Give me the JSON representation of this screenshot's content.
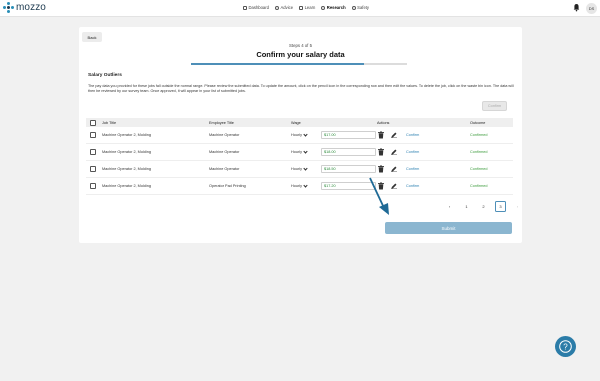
{
  "app": {
    "logo_text": "mozzo"
  },
  "nav": {
    "items": [
      {
        "label": "Dashboard",
        "icon": "dashboard-icon"
      },
      {
        "label": "Advice",
        "icon": "advice-icon"
      },
      {
        "label": "Learn",
        "icon": "learn-icon"
      },
      {
        "label": "Research",
        "icon": "research-icon",
        "active": true
      },
      {
        "label": "Safety",
        "icon": "safety-icon"
      }
    ]
  },
  "user": {
    "initials": "DS"
  },
  "page": {
    "back_label": "Back",
    "steps": "Steps 4 of 5",
    "title": "Confirm your salary data",
    "progress": 0.8
  },
  "section": {
    "title": "Salary Outliers",
    "description": "The pay data you provided for these jobs fall outside the normal range. Please review the submitted data. To update the amount, click on the pencil icon in the corresponding row and then edit the values. To delete the job, click on the waste bin icon. The data will then be reviewed by our survey team. Once approved, it will appear in your list of submitted jobs.",
    "confirm_label": "Confirm"
  },
  "table": {
    "headers": {
      "job_title": "Job Title",
      "employee_title": "Employee Title",
      "wage": "Wage",
      "actions": "Actions",
      "outcome": "Outcome"
    },
    "rows": [
      {
        "job_title": "Machine Operator 2, Molding",
        "employee_title": "Machine Operator",
        "period": "Hourly",
        "wage": "$17.00",
        "action": "Confirm",
        "outcome": "Confirmed"
      },
      {
        "job_title": "Machine Operator 2, Molding",
        "employee_title": "Machine Operator",
        "period": "Hourly",
        "wage": "$18.00",
        "action": "Confirm",
        "outcome": "Confirmed"
      },
      {
        "job_title": "Machine Operator 2, Molding",
        "employee_title": "Machine Operator",
        "period": "Hourly",
        "wage": "$18.50",
        "action": "Confirm",
        "outcome": "Confirmed"
      },
      {
        "job_title": "Machine Operator 2, Molding",
        "employee_title": "Operator Pad Printing",
        "period": "Hourly",
        "wage": "$17.20",
        "action": "Confirm",
        "outcome": "Confirmed"
      }
    ]
  },
  "pagination": {
    "prev": "‹",
    "pages": [
      "1",
      "2",
      "3"
    ],
    "current": "3",
    "next": "›"
  },
  "submit_label": "Submit",
  "colors": {
    "accent": "#2b7ca8",
    "confirmed": "#3a9a3a",
    "submit": "#8bb6d0",
    "annotation_arrow": "#1f6a96"
  }
}
